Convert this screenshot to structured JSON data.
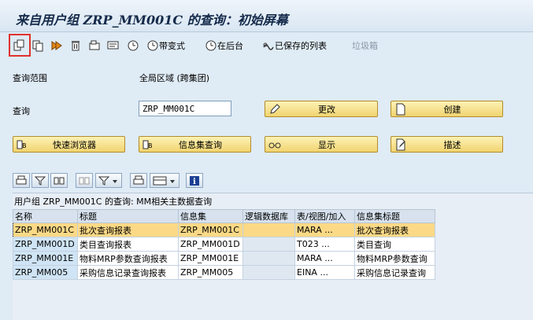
{
  "title": "来自用户组 ZRP_MM001C 的查询：初始屏幕",
  "toolbar": {
    "btn_change_label": "带变式",
    "btn_background_label": "在后台",
    "btn_saved_lists_label": "已保存的列表",
    "btn_trash_label": "垃圾箱"
  },
  "form": {
    "scope_label": "查询范围",
    "scope_value": "全局区域 (跨集团)",
    "query_label": "查询",
    "query_value": "ZRP_MM001C"
  },
  "buttons": {
    "change": "更改",
    "create": "创建",
    "quick_viewer": "快速浏览器",
    "infoset_query": "信息集查询",
    "display": "显示",
    "description": "描述"
  },
  "grid": {
    "title": "用户组 ZRP_MM001C 的查询: MM相关主数据查询",
    "columns": [
      "名称",
      "标题",
      "信息集",
      "逻辑数据库",
      "表/视图/加入",
      "信息集标题"
    ],
    "rows": [
      [
        "ZRP_MM001C",
        "批次查询报表",
        "ZRP_MM001C",
        "",
        "MARA ...",
        "批次查询报表"
      ],
      [
        "ZRP_MM001D",
        "类目查询报表",
        "ZRP_MM001D",
        "",
        "T023 ...",
        "类目查询"
      ],
      [
        "ZRP_MM001E",
        "物料MRP参数查询报表",
        "ZRP_MM001E",
        "",
        "MARA ...",
        "物料MRP参数查询"
      ],
      [
        "ZRP_MM005",
        "采购信息记录查询报表",
        "ZRP_MM005",
        "",
        "EINA ...",
        "采购信息记录查询"
      ]
    ]
  },
  "colors": {
    "background": "#dfebf5",
    "button_gold": "#f1d470",
    "selected_row": "#fbd986",
    "highlight_box": "#e0322d"
  }
}
